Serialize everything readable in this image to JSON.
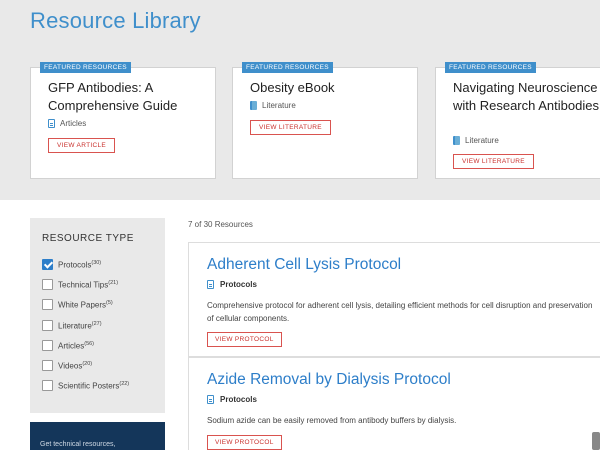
{
  "page_title": "Resource Library",
  "featured": [
    {
      "badge": "FEATURED RESOURCES",
      "title": "GFP Antibodies: A Comprehensive Guide",
      "type": "Articles",
      "icon": "document-icon",
      "button": "VIEW ARTICLE"
    },
    {
      "badge": "FEATURED RESOURCES",
      "title": "Obesity eBook",
      "type": "Literature",
      "icon": "book-icon",
      "button": "VIEW LITERATURE"
    },
    {
      "badge": "FEATURED RESOURCES",
      "title": "Navigating Neuroscience with Research Antibodies",
      "type": "Literature",
      "icon": "book-icon",
      "button": "VIEW LITERATURE"
    }
  ],
  "filter": {
    "title": "RESOURCE TYPE",
    "items": [
      {
        "label": "Protocols",
        "count": "(30)",
        "checked": true
      },
      {
        "label": "Technical Tips",
        "count": "(21)",
        "checked": false
      },
      {
        "label": "White Papers",
        "count": "(5)",
        "checked": false
      },
      {
        "label": "Literature",
        "count": "(27)",
        "checked": false
      },
      {
        "label": "Articles",
        "count": "(56)",
        "checked": false
      },
      {
        "label": "Videos",
        "count": "(20)",
        "checked": false
      },
      {
        "label": "Scientific Posters",
        "count": "(22)",
        "checked": false
      }
    ]
  },
  "promo": {
    "text": "Get technical resources,"
  },
  "results_count": "7 of 30 Resources",
  "results": [
    {
      "title": "Adherent Cell Lysis Protocol",
      "type": "Protocols",
      "description": "Comprehensive protocol for adherent cell lysis, detailing efficient methods for cell disruption and preservation of cellular components.",
      "button": "VIEW PROTOCOL"
    },
    {
      "title": "Azide Removal by Dialysis Protocol",
      "type": "Protocols",
      "description": "Sodium azide can be easily removed from antibody buffers by dialysis.",
      "button": "VIEW PROTOCOL"
    }
  ],
  "colors": {
    "accent": "#3f8fcb",
    "button_border": "#d9534f",
    "panel_bg": "#e9e9e9",
    "promo_bg": "#14365a"
  }
}
